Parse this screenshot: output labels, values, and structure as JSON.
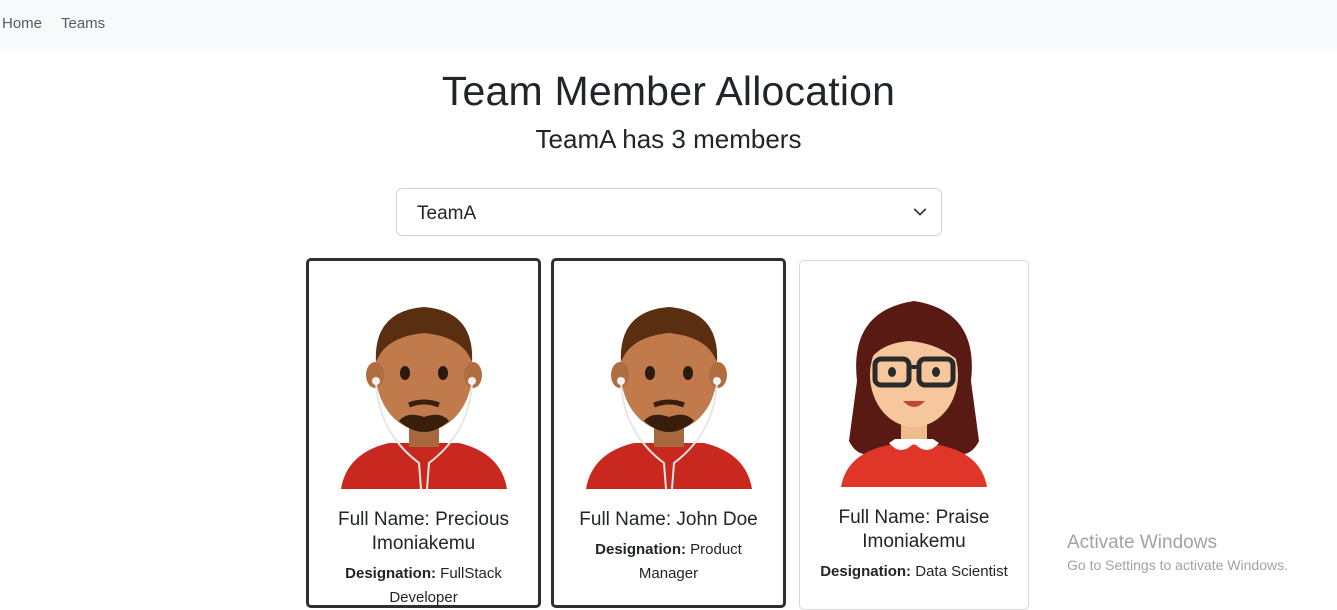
{
  "nav": {
    "home": "Home",
    "teams": "Teams"
  },
  "page": {
    "title": "Team Member Allocation",
    "subtitle": "TeamA has 3 members"
  },
  "select": {
    "value": "TeamA"
  },
  "designation_label": "Designation:",
  "cards": [
    {
      "name": "Full Name: Precious Imoniakemu",
      "designation": "FullStack Developer",
      "avatar": "male-avatar-with-earphones",
      "selected": true
    },
    {
      "name": "Full Name: John Doe",
      "designation": "Product Manager",
      "avatar": "male-avatar-with-earphones",
      "selected": true
    },
    {
      "name": "Full Name: Praise Imoniakemu",
      "designation": "Data Scientist",
      "avatar": "female-avatar-with-glasses",
      "selected": false
    }
  ],
  "watermark": {
    "title": "Activate Windows",
    "subtitle": "Go to Settings to activate Windows."
  },
  "colors": {
    "navbar_bg": "#f8f9fa",
    "selected_border": "#2f2f2f",
    "shirt_red": "#c8281d"
  }
}
